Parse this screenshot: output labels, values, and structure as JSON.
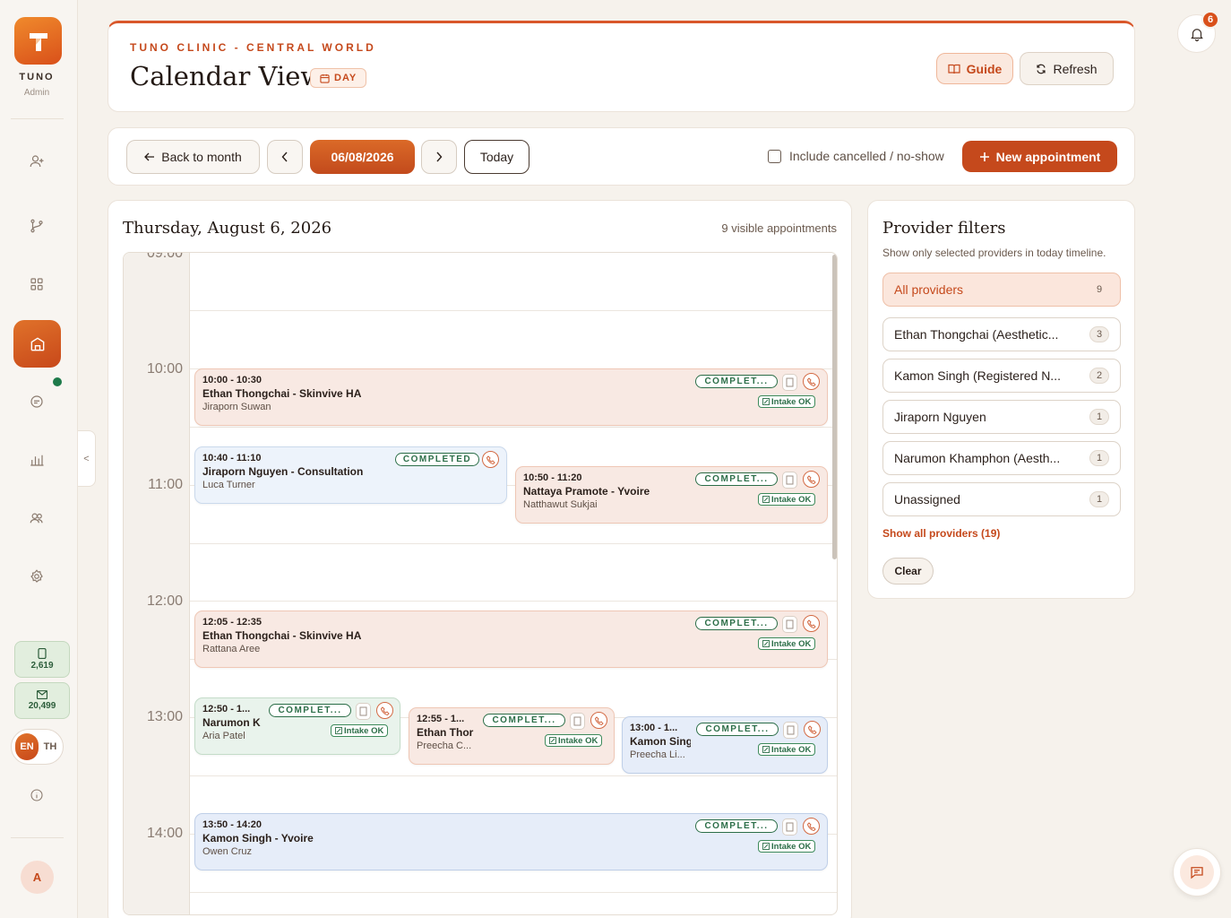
{
  "sidebar": {
    "brand": "TUNO",
    "role": "Admin",
    "nav": [
      "add-user",
      "branch",
      "grid",
      "clinic",
      "chat",
      "reports",
      "team",
      "settings"
    ],
    "sms_count": "2,619",
    "email_count": "20,499",
    "lang_en": "EN",
    "lang_th": "TH",
    "avatar_initial": "A",
    "collapse_label": "<"
  },
  "header": {
    "clinic": "TUNO CLINIC - CENTRAL WORLD",
    "title": "Calendar View",
    "view_badge": "DAY",
    "guide_label": "Guide",
    "refresh_label": "Refresh"
  },
  "toolbar": {
    "back_label": "Back to month",
    "date": "06/08/2026",
    "today_label": "Today",
    "include_cancelled_label": "Include cancelled / no-show",
    "new_label": "New appointment"
  },
  "calendar": {
    "date_heading": "Thursday, August 6, 2026",
    "visible_count": "9 visible appointments",
    "hours": [
      "09:00",
      "10:00",
      "11:00",
      "12:00",
      "13:00",
      "14:00"
    ],
    "appointments": [
      {
        "time": "10:00 - 10:30",
        "title": "Ethan Thongchai - Skinvive HA",
        "client": "Jiraporn Suwan",
        "status": "COMPLET...",
        "intake": "Intake OK"
      },
      {
        "time": "10:40 - 11:10",
        "title": "Jiraporn Nguyen - Consultation",
        "client": "Luca Turner",
        "status": "COMPLETED"
      },
      {
        "time": "10:50 - 11:20",
        "title": "Nattaya Pramote - Yvoire",
        "client": "Natthawut Sukjai",
        "status": "COMPLET...",
        "intake": "Intake OK"
      },
      {
        "time": "12:05 - 12:35",
        "title": "Ethan Thongchai - Skinvive HA",
        "client": "Rattana Aree",
        "status": "COMPLET...",
        "intake": "Intake OK"
      },
      {
        "time": "12:50 - 1...",
        "title": "Narumon K",
        "client": "Aria Patel",
        "status": "COMPLET...",
        "intake": "Intake OK"
      },
      {
        "time": "12:55 - 1...",
        "title": "Ethan Thor",
        "client": "Preecha C...",
        "status": "COMPLET...",
        "intake": "Intake OK"
      },
      {
        "time": "13:00 - 1...",
        "title": "Kamon Sing",
        "client": "Preecha Li...",
        "status": "COMPLET...",
        "intake": "Intake OK"
      },
      {
        "time": "13:50 - 14:20",
        "title": "Kamon Singh - Yvoire",
        "client": "Owen Cruz",
        "status": "COMPLET...",
        "intake": "Intake OK"
      }
    ]
  },
  "providers": {
    "title": "Provider filters",
    "subtitle": "Show only selected providers in today timeline.",
    "items": [
      {
        "name": "All providers",
        "count": "9"
      },
      {
        "name": "Ethan Thongchai (Aesthetic...",
        "count": "3"
      },
      {
        "name": "Kamon Singh (Registered N...",
        "count": "2"
      },
      {
        "name": "Jiraporn Nguyen",
        "count": "1"
      },
      {
        "name": "Narumon Khamphon (Aesth...",
        "count": "1"
      },
      {
        "name": "Unassigned",
        "count": "1"
      }
    ],
    "show_all": "Show all providers (19)",
    "clear_label": "Clear"
  },
  "notifications": {
    "count": "6"
  },
  "colors": {
    "accent": "#c5491c",
    "success": "#2c6e48"
  }
}
